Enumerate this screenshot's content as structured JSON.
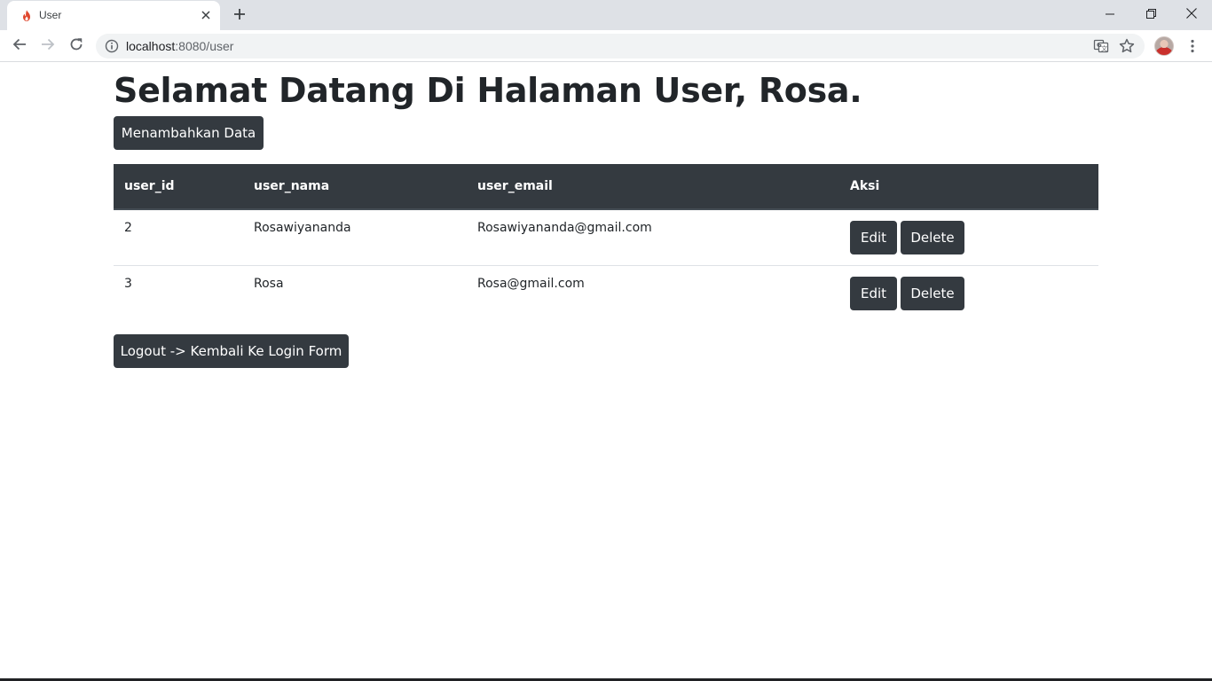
{
  "browser": {
    "tab_title": "User",
    "url_host": "localhost",
    "url_rest": ":8080/user",
    "icons": {
      "favicon": "flame-icon",
      "tab_close": "close-icon",
      "new_tab": "plus-icon",
      "minimize": "minimize-icon",
      "restore": "restore-icon",
      "close_window": "close-icon",
      "back": "back-arrow-icon",
      "forward": "forward-arrow-icon",
      "reload": "reload-icon",
      "site_info": "info-icon",
      "translate": "translate-icon",
      "bookmark": "star-icon",
      "menu": "kebab-menu-icon"
    }
  },
  "page": {
    "title": "Selamat Datang Di Halaman User, Rosa.",
    "add_button": "Menambahkan Data",
    "logout_button": "Logout -> Kembali Ke Login Form",
    "accent_color": "#343a40"
  },
  "table": {
    "headers": [
      "user_id",
      "user_nama",
      "user_email",
      "Aksi"
    ],
    "rows": [
      {
        "user_id": "2",
        "user_nama": "Rosawiyananda",
        "user_email": "Rosawiyananda@gmail.com",
        "edit": "Edit",
        "delete": "Delete"
      },
      {
        "user_id": "3",
        "user_nama": "Rosa",
        "user_email": "Rosa@gmail.com",
        "edit": "Edit",
        "delete": "Delete"
      }
    ]
  }
}
